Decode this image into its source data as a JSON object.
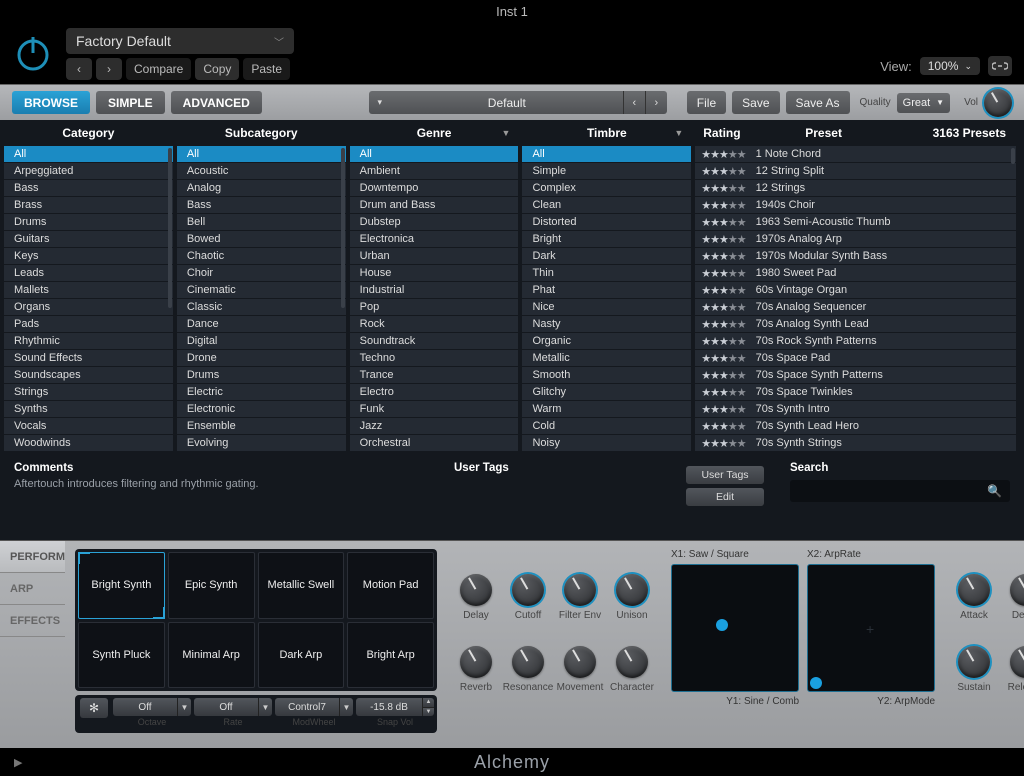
{
  "title": "Inst 1",
  "header": {
    "preset_name": "Factory Default",
    "compare": "Compare",
    "copy": "Copy",
    "paste": "Paste",
    "view_label": "View:",
    "view_value": "100%"
  },
  "toolbar": {
    "browse": "BROWSE",
    "simple": "SIMPLE",
    "advanced": "ADVANCED",
    "preset": "Default",
    "file": "File",
    "save": "Save",
    "save_as": "Save As",
    "quality_label": "Quality",
    "quality_value": "Great",
    "vol_label": "Vol"
  },
  "columns": {
    "category": {
      "title": "Category",
      "items": [
        "All",
        "Arpeggiated",
        "Bass",
        "Brass",
        "Drums",
        "Guitars",
        "Keys",
        "Leads",
        "Mallets",
        "Organs",
        "Pads",
        "Rhythmic",
        "Sound Effects",
        "Soundscapes",
        "Strings",
        "Synths",
        "Vocals",
        "Woodwinds"
      ]
    },
    "subcategory": {
      "title": "Subcategory",
      "items": [
        "All",
        "Acoustic",
        "Analog",
        "Bass",
        "Bell",
        "Bowed",
        "Chaotic",
        "Choir",
        "Cinematic",
        "Classic",
        "Dance",
        "Digital",
        "Drone",
        "Drums",
        "Electric",
        "Electronic",
        "Ensemble",
        "Evolving"
      ]
    },
    "genre": {
      "title": "Genre",
      "items": [
        "All",
        "Ambient",
        "Downtempo",
        "Drum and Bass",
        "Dubstep",
        "Electronica",
        "Urban",
        "House",
        "Industrial",
        "Pop",
        "Rock",
        "Soundtrack",
        "Techno",
        "Trance",
        "Electro",
        "Funk",
        "Jazz",
        "Orchestral"
      ]
    },
    "timbre": {
      "title": "Timbre",
      "items": [
        "All",
        "Simple",
        "Complex",
        "Clean",
        "Distorted",
        "Bright",
        "Dark",
        "Thin",
        "Phat",
        "Nice",
        "Nasty",
        "Organic",
        "Metallic",
        "Smooth",
        "Glitchy",
        "Warm",
        "Cold",
        "Noisy"
      ]
    }
  },
  "preset_col": {
    "rating_title": "Rating",
    "preset_title": "Preset",
    "count": "3163 Presets",
    "items": [
      {
        "rating": 3,
        "name": "1 Note Chord"
      },
      {
        "rating": 3,
        "name": "12 String Split"
      },
      {
        "rating": 3,
        "name": "12 Strings"
      },
      {
        "rating": 3,
        "name": "1940s Choir"
      },
      {
        "rating": 3,
        "name": "1963 Semi-Acoustic Thumb"
      },
      {
        "rating": 3,
        "name": "1970s Analog Arp"
      },
      {
        "rating": 3,
        "name": "1970s Modular Synth Bass"
      },
      {
        "rating": 3,
        "name": "1980 Sweet Pad"
      },
      {
        "rating": 3,
        "name": "60s Vintage Organ"
      },
      {
        "rating": 3,
        "name": "70s Analog Sequencer"
      },
      {
        "rating": 3,
        "name": "70s Analog Synth Lead"
      },
      {
        "rating": 3,
        "name": "70s Rock Synth Patterns"
      },
      {
        "rating": 3,
        "name": "70s Space Pad"
      },
      {
        "rating": 3,
        "name": "70s Space Synth Patterns"
      },
      {
        "rating": 3,
        "name": "70s Space Twinkles"
      },
      {
        "rating": 3,
        "name": "70s Synth Intro"
      },
      {
        "rating": 3,
        "name": "70s Synth Lead Hero"
      },
      {
        "rating": 3,
        "name": "70s Synth Strings"
      }
    ]
  },
  "meta": {
    "comments_title": "Comments",
    "comments_text": "Aftertouch introduces filtering and rhythmic gating.",
    "user_tags_title": "User Tags",
    "user_tags_btn": "User Tags",
    "edit_btn": "Edit",
    "search_title": "Search"
  },
  "perform": {
    "tabs": [
      "PERFORM",
      "ARP",
      "EFFECTS"
    ],
    "pads": [
      "Bright Synth",
      "Epic Synth",
      "Metallic Swell",
      "Motion Pad",
      "Synth Pluck",
      "Minimal Arp",
      "Dark Arp",
      "Bright Arp"
    ],
    "pad_controls": {
      "octave": {
        "value": "Off",
        "label": "Octave"
      },
      "rate": {
        "value": "Off",
        "label": "Rate"
      },
      "modwheel": {
        "value": "Control7",
        "label": "ModWheel"
      },
      "snapvol": {
        "value": "-15.8 dB",
        "label": "Snap Vol"
      }
    },
    "knobs1": [
      "Delay",
      "Cutoff",
      "Filter Env",
      "Unison",
      "Reverb",
      "Resonance",
      "Movement",
      "Character"
    ],
    "xy1": {
      "x": "X1: Saw / Square",
      "y": "Y1: Sine / Comb"
    },
    "xy2": {
      "x": "X2: ArpRate",
      "y": "Y2: ArpMode"
    },
    "knobs2": [
      "Attack",
      "Decay",
      "Sustain",
      "Release"
    ]
  },
  "footer": "Alchemy"
}
